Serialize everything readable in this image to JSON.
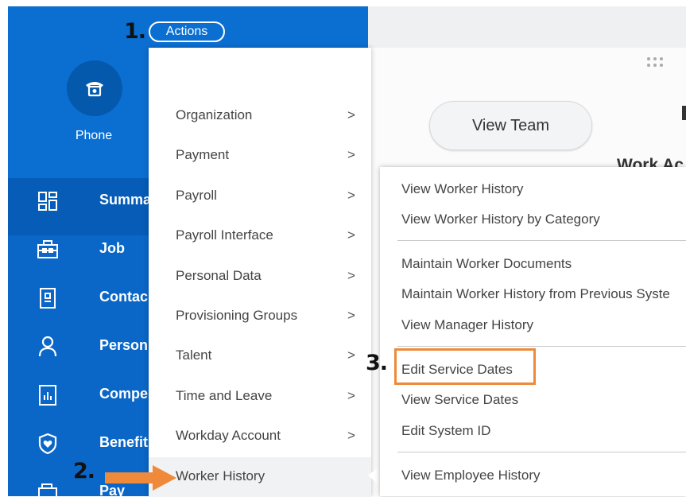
{
  "header": {
    "actions_label": "Actions"
  },
  "annotations": {
    "step1": "1.",
    "step2": "2.",
    "step3": "3."
  },
  "profile": {
    "phone_label": "Phone"
  },
  "nav": {
    "items": [
      {
        "label": "Summa",
        "icon": "grid-icon"
      },
      {
        "label": "Job",
        "icon": "briefcase-icon"
      },
      {
        "label": "Contac",
        "icon": "contact-card-icon"
      },
      {
        "label": "Person",
        "icon": "person-icon"
      },
      {
        "label": "Compe",
        "icon": "chart-icon"
      },
      {
        "label": "Benefit",
        "icon": "shield-heart-icon"
      },
      {
        "label": "Pay",
        "icon": "wallet-icon"
      }
    ]
  },
  "actions_menu": {
    "items": [
      {
        "label": "Organization",
        "chevron": ">"
      },
      {
        "label": "Payment",
        "chevron": ">"
      },
      {
        "label": "Payroll",
        "chevron": ">"
      },
      {
        "label": "Payroll Interface",
        "chevron": ">"
      },
      {
        "label": "Personal Data",
        "chevron": ">"
      },
      {
        "label": "Provisioning Groups",
        "chevron": ">"
      },
      {
        "label": "Talent",
        "chevron": ">"
      },
      {
        "label": "Time and Leave",
        "chevron": ">"
      },
      {
        "label": "Workday Account",
        "chevron": ">"
      },
      {
        "label": "Worker History",
        "chevron": ""
      }
    ]
  },
  "submenu": {
    "groups": [
      [
        "View Worker History",
        "View Worker History by Category"
      ],
      [
        "Maintain Worker Documents",
        "Maintain Worker History from Previous Syste",
        "View Manager History"
      ],
      [
        "Edit Service Dates",
        "View Service Dates",
        "Edit System ID"
      ],
      [
        "View Employee History"
      ]
    ]
  },
  "content": {
    "view_team_label": "View Team",
    "section_title": "Work Ac"
  },
  "colors": {
    "nav_blue": "#0b6fd1",
    "highlight_orange": "#ee8a3a"
  }
}
